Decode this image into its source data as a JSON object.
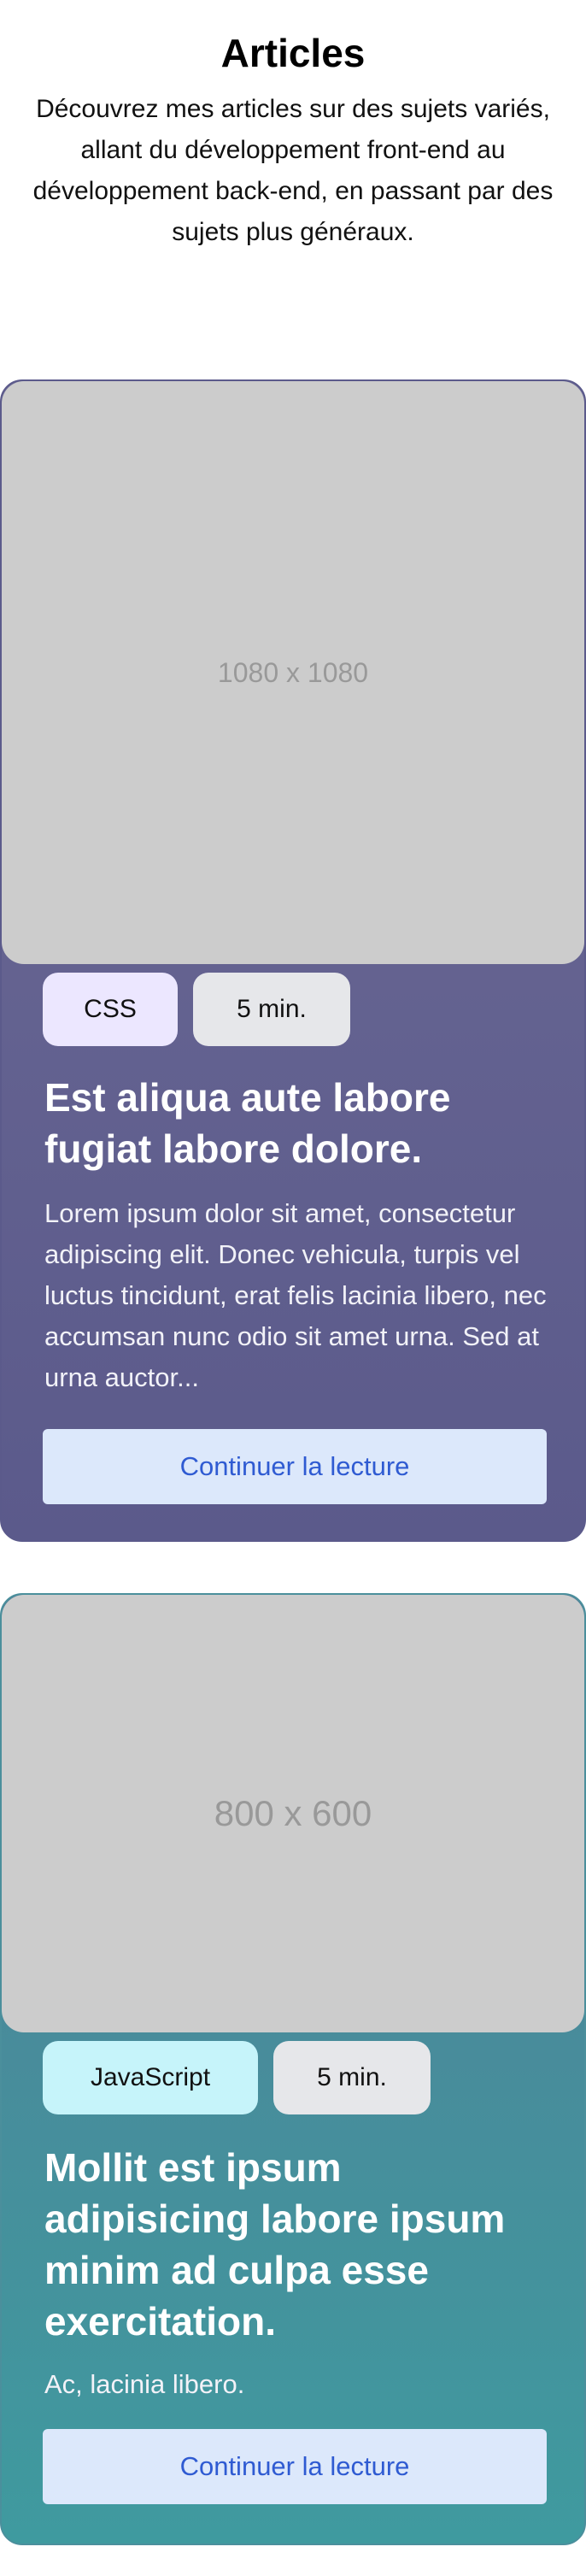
{
  "header": {
    "title": "Articles",
    "intro": "Découvrez mes articles sur des sujets variés, allant du développement front-end au développement back-end, en passant par des sujets plus généraux."
  },
  "articles": [
    {
      "image_placeholder": "1080 x 1080",
      "tag": "CSS",
      "reading_time": "5 min.",
      "title": "Est aliqua aute labore fugiat labore dolore.",
      "excerpt": "Lorem ipsum dolor sit amet, consectetur adipiscing elit. Donec vehicula, turpis vel luctus tincidunt, erat felis lacinia libero, nec accumsan nunc odio sit amet urna. Sed at urna auctor...",
      "cta": "Continuer la lecture"
    },
    {
      "image_placeholder": "800 x 600",
      "tag": "JavaScript",
      "reading_time": "5 min.",
      "title": "Mollit est ipsum adipisicing labore ipsum minim ad culpa esse exercitation.",
      "excerpt": "Ac, lacinia libero.",
      "cta": "Continuer la lecture"
    }
  ],
  "colors": {
    "card_1_bg": "#5b5a8b",
    "card_2_bg": "#3f9a9f",
    "tag_css_bg": "#ece7ff",
    "tag_js_bg": "#c6f4fa",
    "tag_time_bg": "#e6e7ea",
    "cta_bg": "#dce8fb",
    "cta_text": "#2f5bd2",
    "thumb_placeholder": "#cccccc"
  }
}
